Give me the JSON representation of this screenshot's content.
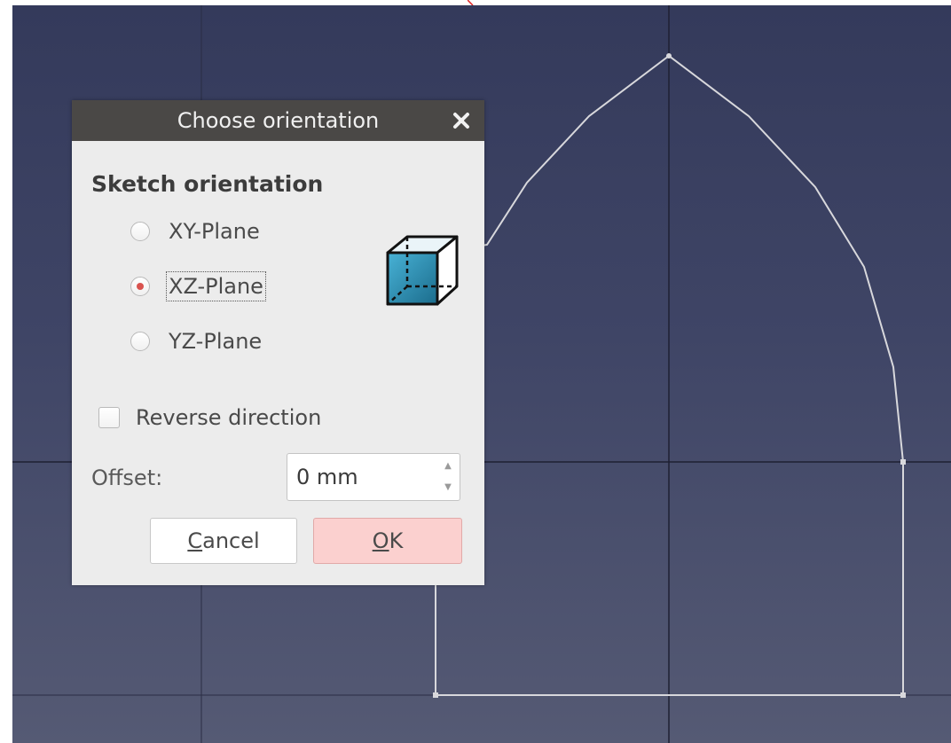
{
  "dialog": {
    "title": "Choose orientation",
    "group_label": "Sketch orientation",
    "options": [
      {
        "label": "XY-Plane",
        "checked": false
      },
      {
        "label": "XZ-Plane",
        "checked": true
      },
      {
        "label": "YZ-Plane",
        "checked": false
      }
    ],
    "reverse_label": "Reverse direction",
    "reverse_checked": false,
    "offset_label": "Offset:",
    "offset_value": "0 mm",
    "cancel": {
      "mnemonic": "C",
      "rest": "ancel"
    },
    "ok": {
      "mnemonic": "O",
      "rest": "K"
    }
  },
  "icons": {
    "close": "close-icon",
    "plane": "cube-plane-icon",
    "spin_up": "spin-up-icon",
    "spin_down": "spin-down-icon"
  },
  "colors": {
    "viewport_top": "#343a5b",
    "viewport_bottom": "#555a74",
    "titlebar": "#4a4846",
    "radio_dot": "#d9534f",
    "ok_button": "#fbd0cf",
    "cube_fill": "#2d8fb5",
    "sketch_line": "#d8d8dc"
  }
}
